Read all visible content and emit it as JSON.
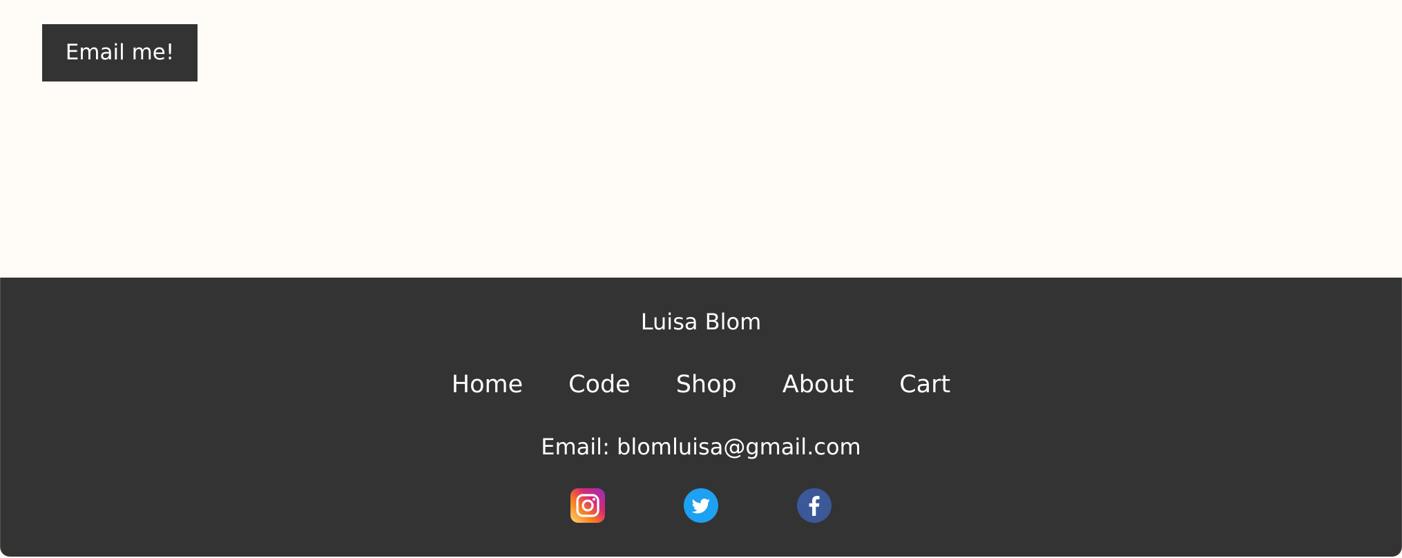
{
  "contact": {
    "email_button_label": "Email me!"
  },
  "footer": {
    "title": "Luisa Blom",
    "nav": [
      {
        "label": "Home"
      },
      {
        "label": "Code"
      },
      {
        "label": "Shop"
      },
      {
        "label": "About"
      },
      {
        "label": "Cart"
      }
    ],
    "email_line": "Email: blomluisa@gmail.com",
    "social": [
      {
        "icon": "instagram-icon",
        "color": "#e1306c"
      },
      {
        "icon": "twitter-icon",
        "color": "#1da1f2"
      },
      {
        "icon": "facebook-icon",
        "color": "#3b5998"
      }
    ]
  },
  "colors": {
    "page_background": "#fffcf7",
    "dark": "#333333",
    "text_light": "#ffffff"
  }
}
